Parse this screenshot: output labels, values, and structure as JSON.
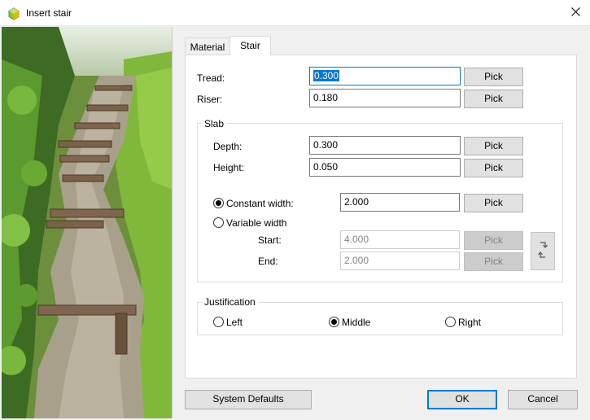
{
  "window": {
    "title": "Insert stair"
  },
  "tabs": {
    "material": "Material",
    "stair": "Stair"
  },
  "stair": {
    "tread_label": "Tread:",
    "tread_value": "0.300",
    "riser_label": "Riser:",
    "riser_value": "0.180",
    "pick": "Pick"
  },
  "slab": {
    "title": "Slab",
    "depth_label": "Depth:",
    "depth_value": "0.300",
    "height_label": "Height:",
    "height_value": "0.050",
    "constant_width_label": "Constant width:",
    "constant_width_value": "2.000",
    "variable_width_label": "Variable width",
    "start_label": "Start:",
    "start_value": "4.000",
    "end_label": "End:",
    "end_value": "2.000",
    "width_mode": "constant"
  },
  "justification": {
    "title": "Justification",
    "left": "Left",
    "middle": "Middle",
    "right": "Right",
    "selected": "Middle"
  },
  "buttons": {
    "system_defaults": "System Defaults",
    "ok": "OK",
    "cancel": "Cancel"
  },
  "colors": {
    "accent": "#0078d7",
    "app_icon": "#8cc63f"
  },
  "icons": {
    "app": "app-logo-icon",
    "close": "close-icon",
    "swap": "swap-arrows-icon"
  }
}
